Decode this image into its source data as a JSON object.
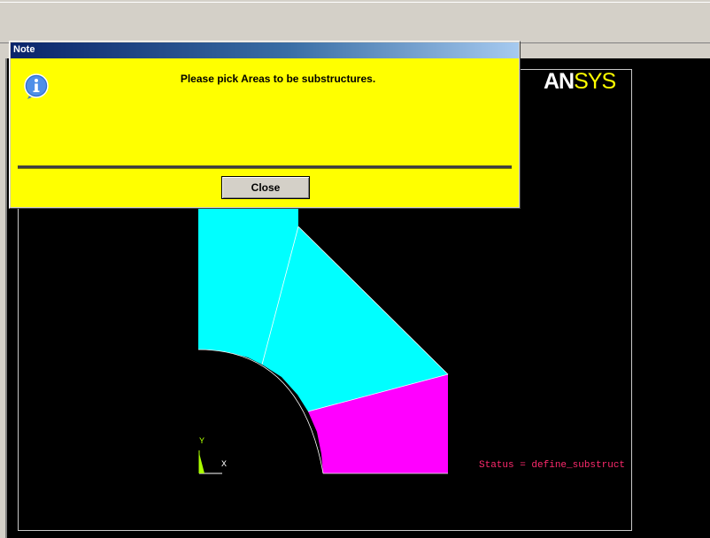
{
  "graphics": {
    "logo_an": "AN",
    "logo_sys": "SYS",
    "status_text": "Status = define_substruct",
    "axis_y_label": "Y",
    "axis_x_label": "X"
  },
  "dialog": {
    "title": "Note",
    "message": "Please pick Areas to be substructures.",
    "close_label": "Close",
    "icon": "info-icon"
  },
  "colors": {
    "graphics_background": "#000000",
    "dialog_background": "#ffff00",
    "area_upper": "#00ffff",
    "area_lower": "#ff00ff",
    "status_text": "#ff2a6e"
  }
}
